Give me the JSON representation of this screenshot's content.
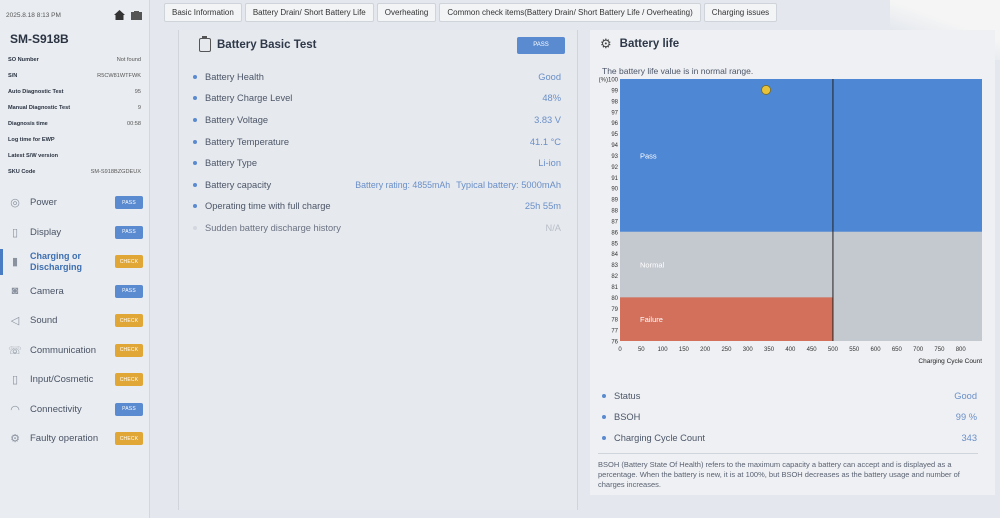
{
  "status_bar": {
    "time": "2025.8.18 8:13 PM"
  },
  "device": {
    "model": "SM-S918B",
    "info": [
      {
        "key": "SO Number",
        "value": "Not found"
      },
      {
        "key": "S/N",
        "value": "R5CW81WTFWK"
      },
      {
        "key": "Auto Diagnostic Test",
        "value": "95"
      },
      {
        "key": "Manual Diagnostic Test",
        "value": "9"
      },
      {
        "key": "Diagnosis time",
        "value": "00:58"
      },
      {
        "key": "Log time for EWP",
        "value": ""
      },
      {
        "key": "Latest S/W version",
        "value": ""
      },
      {
        "key": "SKU Code",
        "value": "SM-S918BZGDEUX"
      }
    ]
  },
  "categories": [
    {
      "label": "Power",
      "status": "PASS",
      "icon": "power-icon"
    },
    {
      "label": "Display",
      "status": "PASS",
      "icon": "display-icon"
    },
    {
      "label": "Charging or Discharging",
      "status": "CHECK",
      "icon": "battery-charging-icon"
    },
    {
      "label": "Camera",
      "status": "PASS",
      "icon": "camera-icon"
    },
    {
      "label": "Sound",
      "status": "CHECK",
      "icon": "sound-icon"
    },
    {
      "label": "Communication",
      "status": "CHECK",
      "icon": "communication-icon"
    },
    {
      "label": "Input/Cosmetic",
      "status": "CHECK",
      "icon": "phone-icon"
    },
    {
      "label": "Connectivity",
      "status": "PASS",
      "icon": "wifi-icon"
    },
    {
      "label": "Faulty operation",
      "status": "CHECK",
      "icon": "gear-icon"
    }
  ],
  "tabs": [
    "Basic Information",
    "Battery Drain/ Short Battery Life",
    "Overheating",
    "Common check items(Battery Drain/ Short Battery Life / Overheating)",
    "Charging issues"
  ],
  "basic_test": {
    "title": "Battery Basic Test",
    "result": "PASS",
    "rows": [
      {
        "label": "Battery Health",
        "value": "Good"
      },
      {
        "label": "Battery Charge Level",
        "value": "48%"
      },
      {
        "label": "Battery Voltage",
        "value": "3.83 V"
      },
      {
        "label": "Battery Temperature",
        "value": "41.1 °C"
      },
      {
        "label": "Battery Type",
        "value": "Li-ion"
      },
      {
        "label": "Battery capacity",
        "value_extra": "Battery rating: 4855mAh",
        "value": "Typical battery: 5000mAh"
      },
      {
        "label": "Operating time with full charge",
        "value": "25h 55m"
      },
      {
        "label": "Sudden battery discharge history",
        "value": "N/A"
      }
    ]
  },
  "battery_life": {
    "title": "Battery life",
    "note": "The battery life value is in normal range.",
    "stats": [
      {
        "label": "Status",
        "value": "Good"
      },
      {
        "label": "BSOH",
        "value": "99 %"
      },
      {
        "label": "Charging Cycle Count",
        "value": "343"
      }
    ],
    "description": "BSOH (Battery State Of Health) refers to the maximum capacity a battery can accept and is displayed as a percentage. When the battery is new, it is at 100%, but BSOH decreases as the battery usage and number of charges increases."
  },
  "chart_data": {
    "type": "scatter",
    "xlabel": "Charging Cycle Count",
    "ylabel": "(%)",
    "xlim": [
      0,
      850
    ],
    "ylim": [
      76,
      100
    ],
    "x_ticks": [
      0,
      50,
      100,
      150,
      200,
      250,
      300,
      350,
      400,
      450,
      500,
      550,
      600,
      650,
      700,
      750,
      800
    ],
    "y_ticks": [
      76,
      77,
      78,
      79,
      80,
      81,
      82,
      83,
      84,
      85,
      86,
      87,
      88,
      89,
      90,
      91,
      92,
      93,
      94,
      95,
      96,
      97,
      98,
      99,
      100
    ],
    "zones": [
      {
        "name": "Pass",
        "y_from": 86,
        "y_to": 100,
        "color": "#4e87d4"
      },
      {
        "name": "Normal",
        "y_from": 80,
        "y_to": 86,
        "color": "#c4c8cf"
      },
      {
        "name": "Failure",
        "y_from": 76,
        "y_to": 80,
        "color": "#d2705c"
      }
    ],
    "threshold_x": 500,
    "point": {
      "x": 343,
      "y": 99,
      "color": "#e8c33a"
    }
  }
}
